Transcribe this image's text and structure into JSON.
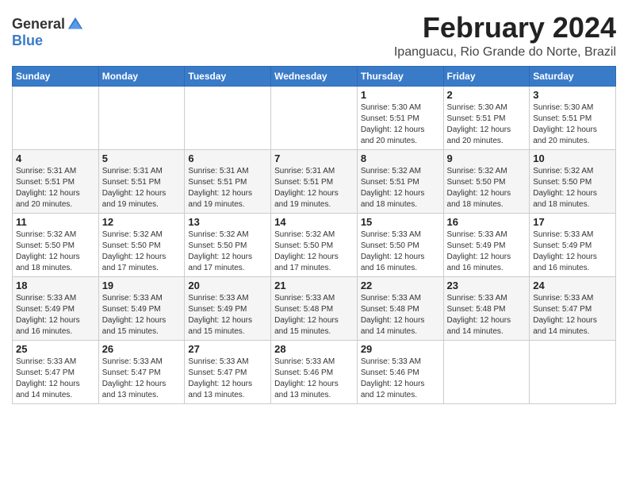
{
  "logo": {
    "general": "General",
    "blue": "Blue"
  },
  "header": {
    "month": "February 2024",
    "location": "Ipanguacu, Rio Grande do Norte, Brazil"
  },
  "weekdays": [
    "Sunday",
    "Monday",
    "Tuesday",
    "Wednesday",
    "Thursday",
    "Friday",
    "Saturday"
  ],
  "weeks": [
    [
      {
        "day": "",
        "info": ""
      },
      {
        "day": "",
        "info": ""
      },
      {
        "day": "",
        "info": ""
      },
      {
        "day": "",
        "info": ""
      },
      {
        "day": "1",
        "info": "Sunrise: 5:30 AM\nSunset: 5:51 PM\nDaylight: 12 hours\nand 20 minutes."
      },
      {
        "day": "2",
        "info": "Sunrise: 5:30 AM\nSunset: 5:51 PM\nDaylight: 12 hours\nand 20 minutes."
      },
      {
        "day": "3",
        "info": "Sunrise: 5:30 AM\nSunset: 5:51 PM\nDaylight: 12 hours\nand 20 minutes."
      }
    ],
    [
      {
        "day": "4",
        "info": "Sunrise: 5:31 AM\nSunset: 5:51 PM\nDaylight: 12 hours\nand 20 minutes."
      },
      {
        "day": "5",
        "info": "Sunrise: 5:31 AM\nSunset: 5:51 PM\nDaylight: 12 hours\nand 19 minutes."
      },
      {
        "day": "6",
        "info": "Sunrise: 5:31 AM\nSunset: 5:51 PM\nDaylight: 12 hours\nand 19 minutes."
      },
      {
        "day": "7",
        "info": "Sunrise: 5:31 AM\nSunset: 5:51 PM\nDaylight: 12 hours\nand 19 minutes."
      },
      {
        "day": "8",
        "info": "Sunrise: 5:32 AM\nSunset: 5:51 PM\nDaylight: 12 hours\nand 18 minutes."
      },
      {
        "day": "9",
        "info": "Sunrise: 5:32 AM\nSunset: 5:50 PM\nDaylight: 12 hours\nand 18 minutes."
      },
      {
        "day": "10",
        "info": "Sunrise: 5:32 AM\nSunset: 5:50 PM\nDaylight: 12 hours\nand 18 minutes."
      }
    ],
    [
      {
        "day": "11",
        "info": "Sunrise: 5:32 AM\nSunset: 5:50 PM\nDaylight: 12 hours\nand 18 minutes."
      },
      {
        "day": "12",
        "info": "Sunrise: 5:32 AM\nSunset: 5:50 PM\nDaylight: 12 hours\nand 17 minutes."
      },
      {
        "day": "13",
        "info": "Sunrise: 5:32 AM\nSunset: 5:50 PM\nDaylight: 12 hours\nand 17 minutes."
      },
      {
        "day": "14",
        "info": "Sunrise: 5:32 AM\nSunset: 5:50 PM\nDaylight: 12 hours\nand 17 minutes."
      },
      {
        "day": "15",
        "info": "Sunrise: 5:33 AM\nSunset: 5:50 PM\nDaylight: 12 hours\nand 16 minutes."
      },
      {
        "day": "16",
        "info": "Sunrise: 5:33 AM\nSunset: 5:49 PM\nDaylight: 12 hours\nand 16 minutes."
      },
      {
        "day": "17",
        "info": "Sunrise: 5:33 AM\nSunset: 5:49 PM\nDaylight: 12 hours\nand 16 minutes."
      }
    ],
    [
      {
        "day": "18",
        "info": "Sunrise: 5:33 AM\nSunset: 5:49 PM\nDaylight: 12 hours\nand 16 minutes."
      },
      {
        "day": "19",
        "info": "Sunrise: 5:33 AM\nSunset: 5:49 PM\nDaylight: 12 hours\nand 15 minutes."
      },
      {
        "day": "20",
        "info": "Sunrise: 5:33 AM\nSunset: 5:49 PM\nDaylight: 12 hours\nand 15 minutes."
      },
      {
        "day": "21",
        "info": "Sunrise: 5:33 AM\nSunset: 5:48 PM\nDaylight: 12 hours\nand 15 minutes."
      },
      {
        "day": "22",
        "info": "Sunrise: 5:33 AM\nSunset: 5:48 PM\nDaylight: 12 hours\nand 14 minutes."
      },
      {
        "day": "23",
        "info": "Sunrise: 5:33 AM\nSunset: 5:48 PM\nDaylight: 12 hours\nand 14 minutes."
      },
      {
        "day": "24",
        "info": "Sunrise: 5:33 AM\nSunset: 5:47 PM\nDaylight: 12 hours\nand 14 minutes."
      }
    ],
    [
      {
        "day": "25",
        "info": "Sunrise: 5:33 AM\nSunset: 5:47 PM\nDaylight: 12 hours\nand 14 minutes."
      },
      {
        "day": "26",
        "info": "Sunrise: 5:33 AM\nSunset: 5:47 PM\nDaylight: 12 hours\nand 13 minutes."
      },
      {
        "day": "27",
        "info": "Sunrise: 5:33 AM\nSunset: 5:47 PM\nDaylight: 12 hours\nand 13 minutes."
      },
      {
        "day": "28",
        "info": "Sunrise: 5:33 AM\nSunset: 5:46 PM\nDaylight: 12 hours\nand 13 minutes."
      },
      {
        "day": "29",
        "info": "Sunrise: 5:33 AM\nSunset: 5:46 PM\nDaylight: 12 hours\nand 12 minutes."
      },
      {
        "day": "",
        "info": ""
      },
      {
        "day": "",
        "info": ""
      }
    ]
  ]
}
